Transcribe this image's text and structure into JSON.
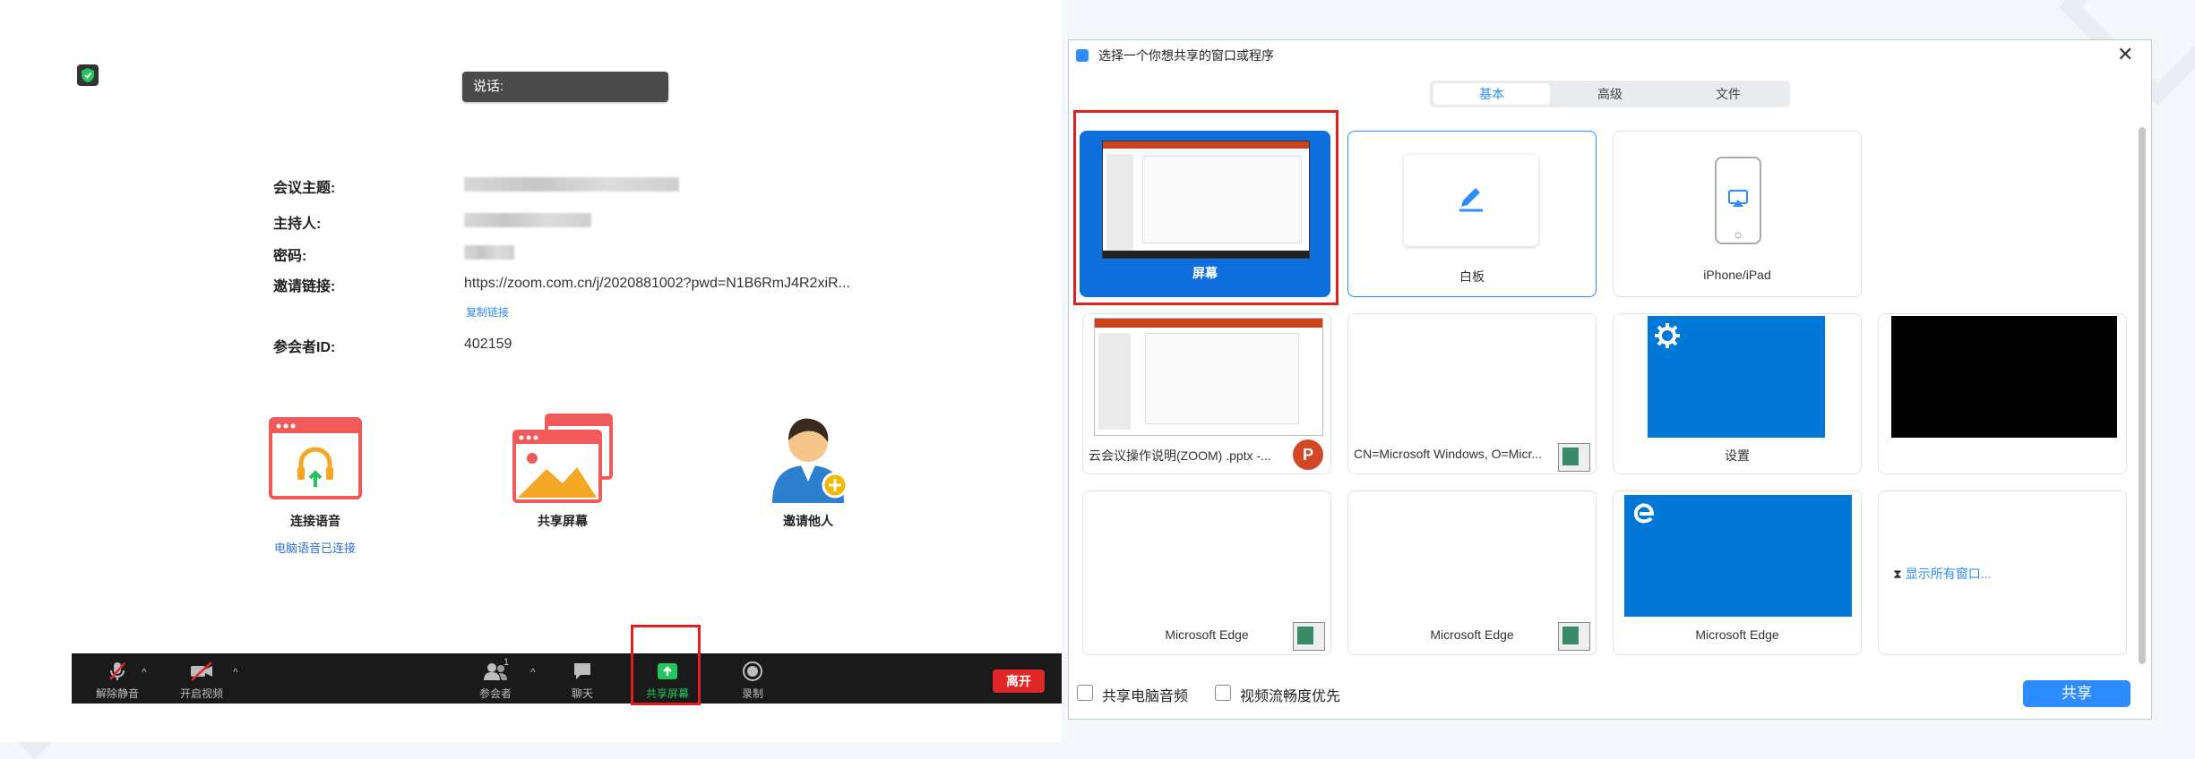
{
  "meeting": {
    "talk_badge": "说话:",
    "info": {
      "topic_label": "会议主题:",
      "host_label": "主持人:",
      "password_label": "密码:",
      "invite_label": "邀请链接:",
      "invite_url": "https://zoom.com.cn/j/2020881002?pwd=N1B6RmJ4R2xiR...",
      "copy_link": "复制链接",
      "participant_id_label": "参会者ID:",
      "participant_id": "402159"
    },
    "actions": {
      "join_audio": "连接语音",
      "join_audio_sub": "电脑语音已连接",
      "share_screen": "共享屏幕",
      "invite": "邀请他人"
    },
    "toolbar": {
      "mute": "解除静音",
      "video": "开启视频",
      "participants": "参会者",
      "participants_count": "1",
      "chat": "聊天",
      "share": "共享屏幕",
      "record": "录制",
      "leave": "离开"
    }
  },
  "dialog": {
    "title": "选择一个你想共享的窗口或程序",
    "tabs": [
      "基本",
      "高级",
      "文件"
    ],
    "cards": {
      "screen": "屏幕",
      "whiteboard": "白板",
      "iphone": "iPhone/iPad",
      "pptx": "云会议操作说明(ZOOM) .pptx -...",
      "cn_window": "CN=Microsoft Windows, O=Micr...",
      "settings": "设置",
      "edge1": "Microsoft Edge",
      "edge2": "Microsoft Edge",
      "edge3": "Microsoft Edge",
      "show_all": "显示所有窗口..."
    },
    "footer": {
      "share_audio": "共享电脑音频",
      "video_priority": "视频流畅度优先",
      "share_button": "共享"
    }
  },
  "colors": {
    "accent": "#2d8cff",
    "leave": "#e02828",
    "highlight_box": "#e02020",
    "toolbar_bg": "#1a1a1a",
    "share_active": "#22c55e"
  }
}
